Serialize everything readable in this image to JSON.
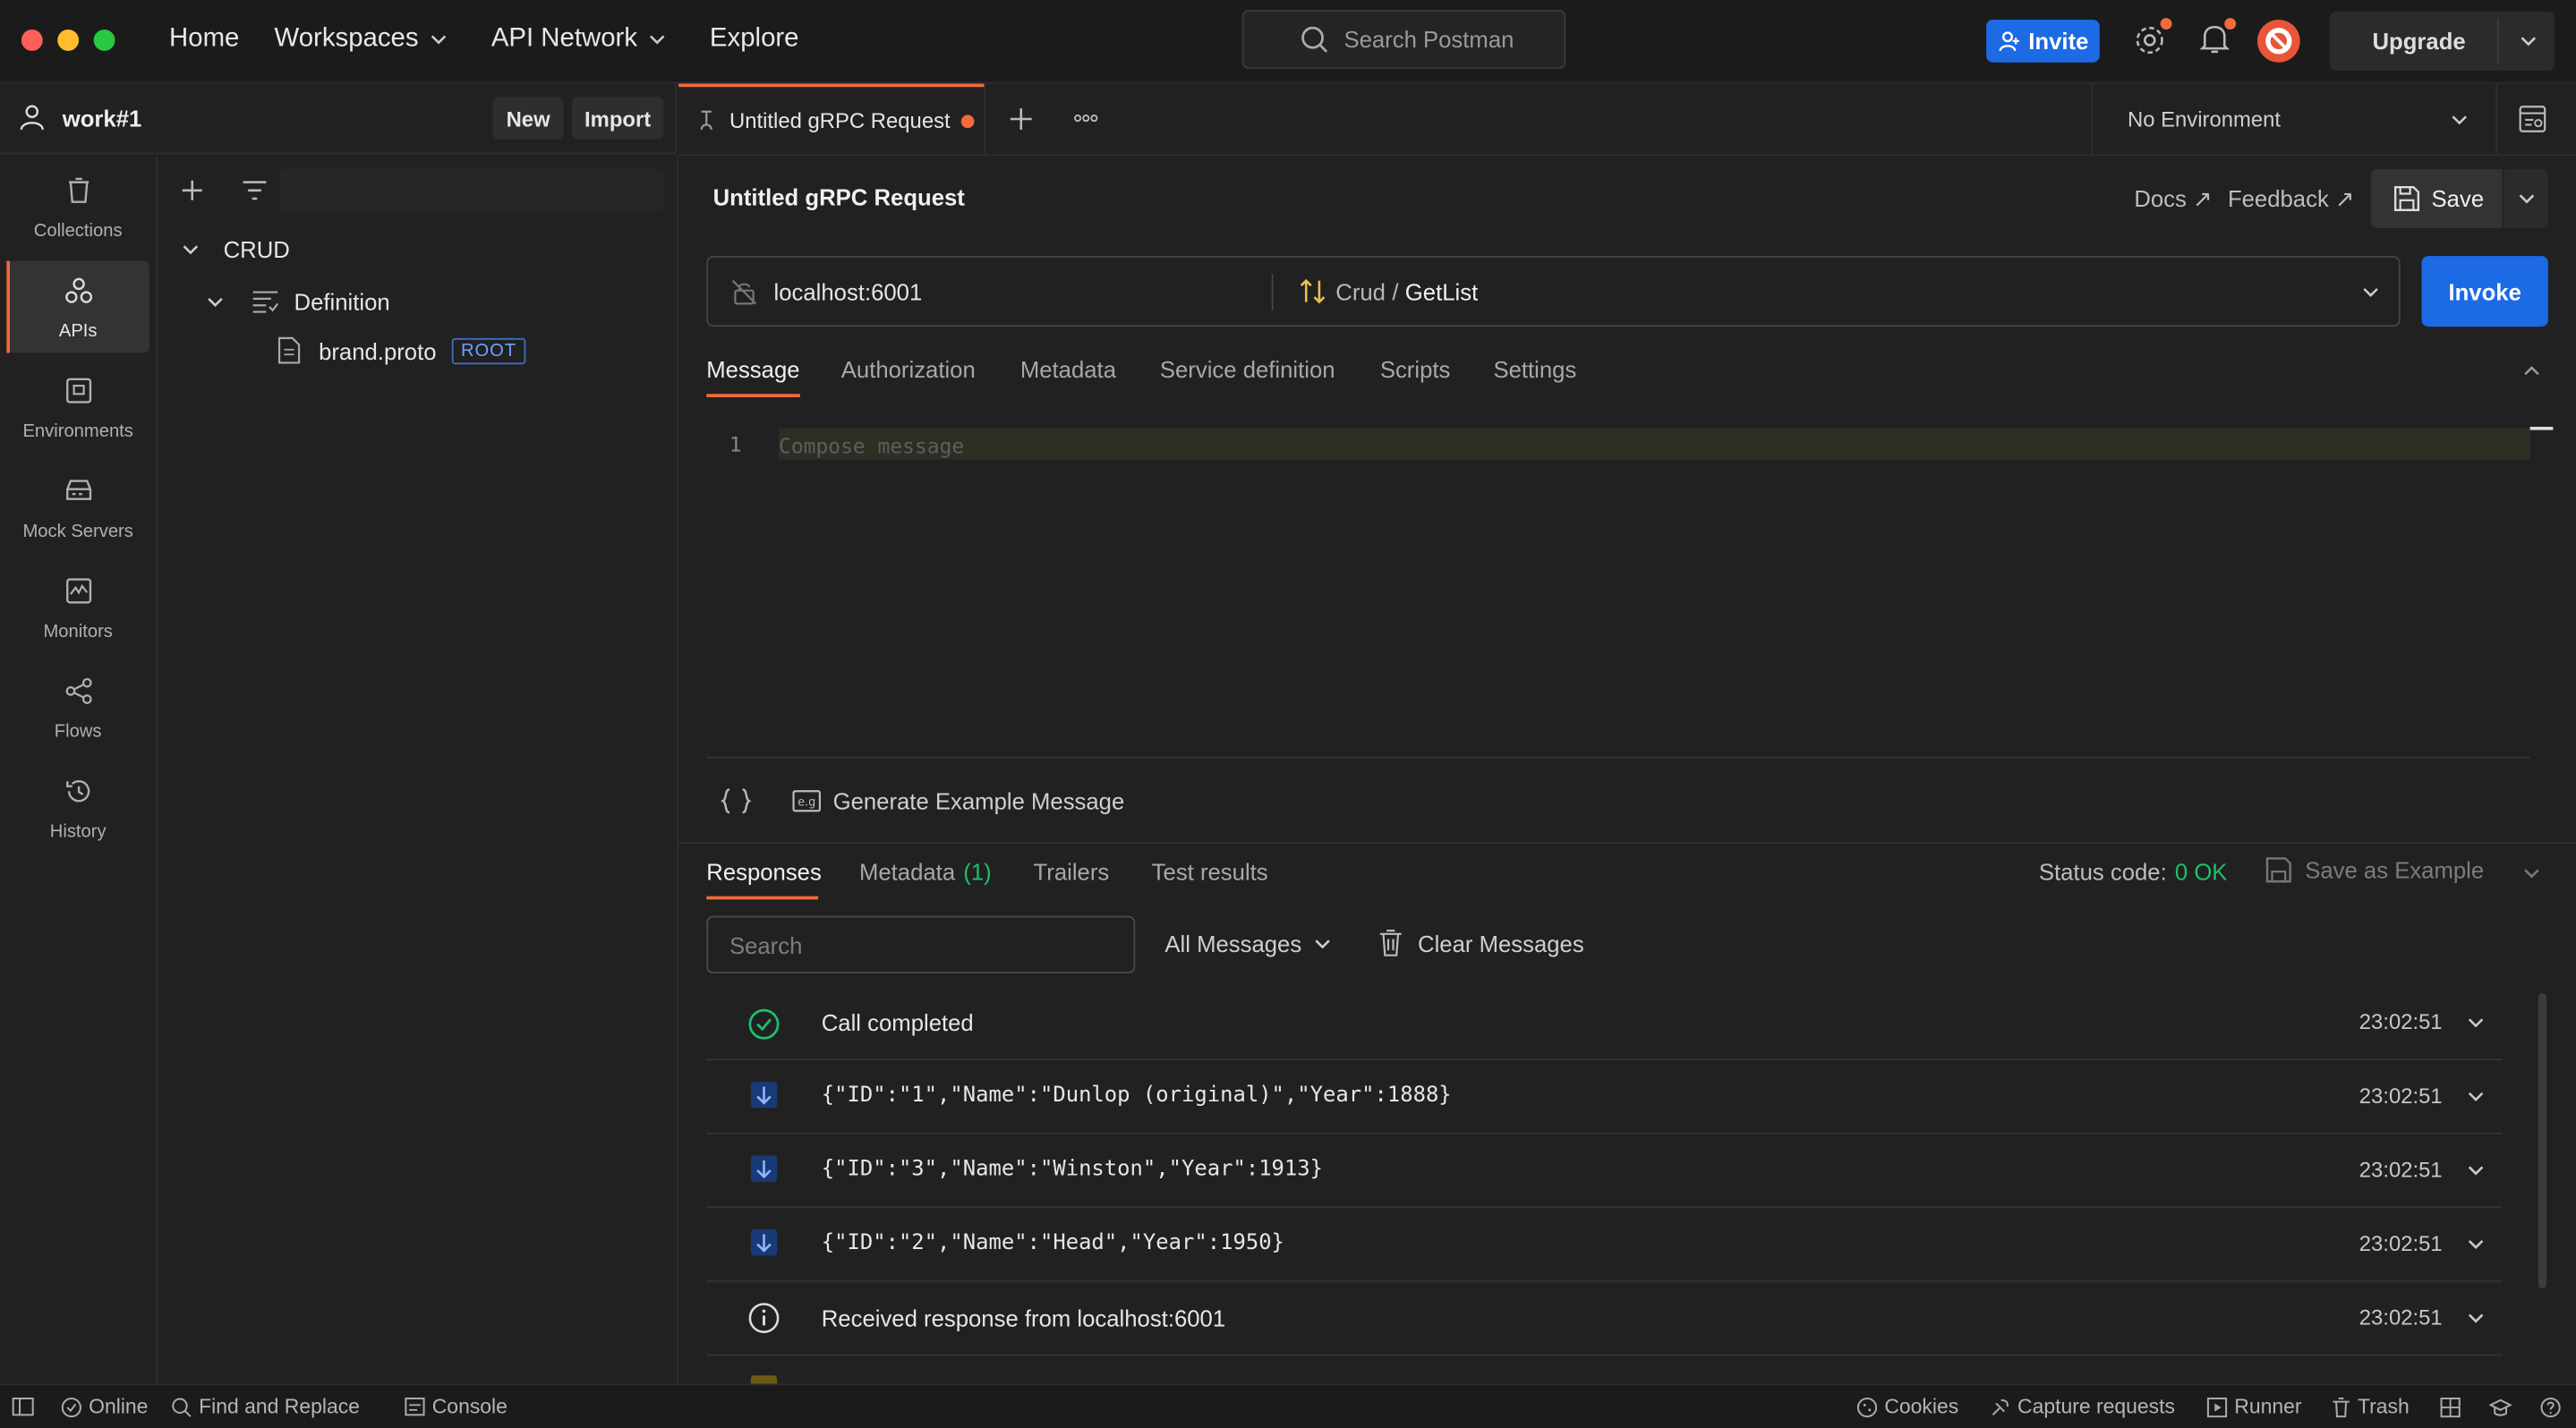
{
  "titlebar": {
    "nav": {
      "home": "Home",
      "workspaces": "Workspaces",
      "api_network": "API Network",
      "explore": "Explore"
    },
    "search_placeholder": "Search Postman",
    "invite": "Invite",
    "upgrade": "Upgrade"
  },
  "workspace": {
    "name": "work#1",
    "new": "New",
    "import": "Import"
  },
  "rail": [
    {
      "label": "Collections",
      "icon": "trash-can-icon"
    },
    {
      "label": "APIs",
      "icon": "apis-icon"
    },
    {
      "label": "Environments",
      "icon": "environment-icon"
    },
    {
      "label": "Mock Servers",
      "icon": "server-icon"
    },
    {
      "label": "Monitors",
      "icon": "monitor-icon"
    },
    {
      "label": "Flows",
      "icon": "flows-icon"
    },
    {
      "label": "History",
      "icon": "history-icon"
    }
  ],
  "tree": {
    "root": "CRUD",
    "folder": "Definition",
    "file": "brand.proto",
    "file_badge": "ROOT"
  },
  "tabs": {
    "active": "Untitled gRPC Request",
    "environment": "No Environment"
  },
  "request": {
    "title": "Untitled gRPC Request",
    "docs": "Docs ↗",
    "feedback": "Feedback ↗",
    "save": "Save",
    "url": "localhost:6001",
    "service": "Crud",
    "method_sep": "/",
    "method": "GetList",
    "invoke": "Invoke"
  },
  "req_tabs": [
    "Message",
    "Authorization",
    "Metadata",
    "Service definition",
    "Scripts",
    "Settings"
  ],
  "editor": {
    "line_number": "1",
    "placeholder": "Compose message"
  },
  "generate": "Generate Example Message",
  "resp_tabs": {
    "responses": "Responses",
    "metadata": "Metadata",
    "metadata_count": "(1)",
    "trailers": "Trailers",
    "tests": "Test results"
  },
  "status": {
    "label": "Status code:",
    "value": "0 OK",
    "save_example": "Save as Example"
  },
  "resp_toolbar": {
    "search_placeholder": "Search",
    "filter": "All Messages",
    "clear": "Clear Messages"
  },
  "messages": [
    {
      "kind": "check-circle-icon",
      "text": "Call completed",
      "time": "23:02:51",
      "mono": false
    },
    {
      "kind": "arrow-down-icon",
      "text": "{\"ID\":\"1\",\"Name\":\"Dunlop (original)\",\"Year\":1888}",
      "time": "23:02:51",
      "mono": true
    },
    {
      "kind": "arrow-down-icon",
      "text": "{\"ID\":\"3\",\"Name\":\"Winston\",\"Year\":1913}",
      "time": "23:02:51",
      "mono": true
    },
    {
      "kind": "arrow-down-icon",
      "text": "{\"ID\":\"2\",\"Name\":\"Head\",\"Year\":1950}",
      "time": "23:02:51",
      "mono": true
    },
    {
      "kind": "info-icon",
      "text": "Received response from localhost:6001",
      "time": "23:02:51",
      "mono": false
    }
  ],
  "statusbar": {
    "online": "Online",
    "find": "Find and Replace",
    "console": "Console",
    "cookies": "Cookies",
    "capture": "Capture requests",
    "runner": "Runner",
    "trash": "Trash"
  },
  "colors": {
    "accent": "#f26b3a",
    "primary": "#1c6ae4",
    "ok": "#1fbf6b"
  }
}
